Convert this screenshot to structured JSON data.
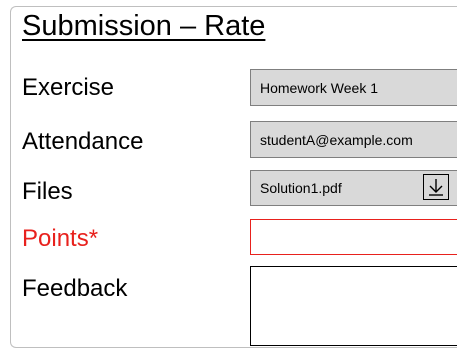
{
  "form": {
    "title": "Submission – Rate",
    "labels": {
      "exercise": "Exercise",
      "attendance": "Attendance",
      "files": "Files",
      "points": "Points*",
      "feedback": "Feedback"
    },
    "values": {
      "exercise": "Homework Week 1",
      "attendance": "studentA@example.com",
      "file_name": "Solution1.pdf",
      "points": "",
      "feedback": ""
    },
    "icons": {
      "download": "download-icon"
    },
    "colors": {
      "required": "#e8211d",
      "readonly_bg": "#d9d9d9"
    }
  }
}
